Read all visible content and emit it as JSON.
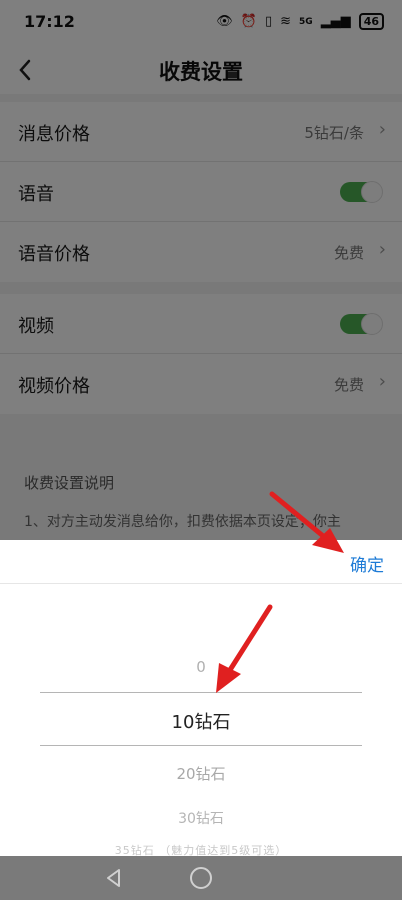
{
  "status_bar": {
    "time": "17:12",
    "network": "5G",
    "battery": "46"
  },
  "header": {
    "title": "收费设置"
  },
  "settings": {
    "group1": [
      {
        "label": "消息价格",
        "value": "5钻石/条",
        "type": "link"
      },
      {
        "label": "语音",
        "type": "toggle",
        "on": true
      },
      {
        "label": "语音价格",
        "value": "免费",
        "type": "link"
      }
    ],
    "group2": [
      {
        "label": "视频",
        "type": "toggle",
        "on": true
      },
      {
        "label": "视频价格",
        "value": "免费",
        "type": "link"
      }
    ]
  },
  "description": {
    "title": "收费设置说明",
    "text": "1、对方主动发消息给你，扣费依据本页设定；你主"
  },
  "picker": {
    "confirm_label": "确定",
    "options": [
      "0",
      "10钻石",
      "20钻石",
      "30钻石",
      "35钻石 （魅力值达到5级可选）"
    ],
    "selected": "10钻石"
  },
  "colors": {
    "accent": "#1e7bd6",
    "toggle_on": "#4caf50",
    "annotation": "#e02020"
  },
  "icons": {
    "back": "chevron-left-icon",
    "nav_back": "triangle-back-icon",
    "nav_home": "circle-home-icon"
  }
}
